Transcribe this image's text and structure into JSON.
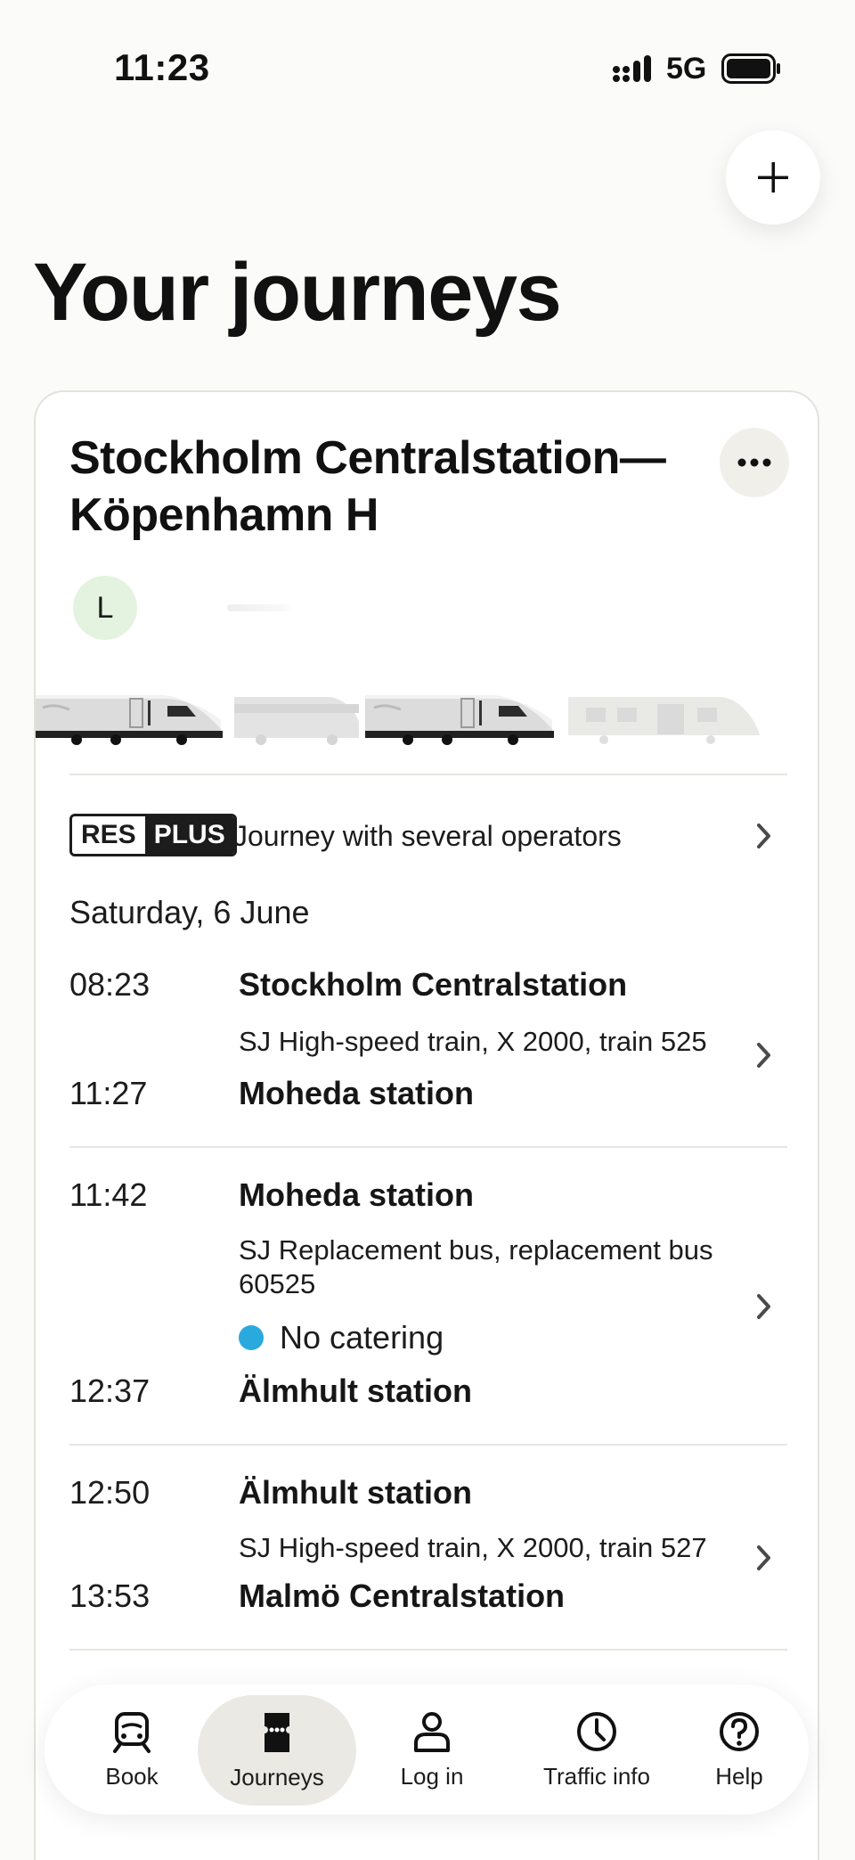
{
  "status_bar": {
    "time": "11:23",
    "network": "5G"
  },
  "page": {
    "title": "Your journeys"
  },
  "journey": {
    "route_title": "Stockholm Centralstation—Köpenhamn H",
    "route_line1": "Stockholm Centralstation—",
    "route_line2": "Köpenhamn H",
    "avatar_initial": "L",
    "res_label": "RES",
    "plus_label": "PLUS",
    "operators_text": "Journey with several operators",
    "date": "Saturday, 6 June",
    "legs": [
      {
        "dep_time": "08:23",
        "dep_station": "Stockholm Centralstation",
        "service": "SJ High-speed train, X 2000, train 525",
        "arr_time": "11:27",
        "arr_station": "Moheda station"
      },
      {
        "dep_time": "11:42",
        "dep_station": "Moheda station",
        "service": "SJ Replacement bus, replacement bus 60525",
        "catering": "No catering",
        "arr_time": "12:37",
        "arr_station": "Älmhult station"
      },
      {
        "dep_time": "12:50",
        "dep_station": "Älmhult station",
        "service": "SJ High-speed train, X 2000, train 527",
        "arr_time": "13:53",
        "arr_station": "Malmö Centralstation"
      }
    ]
  },
  "nav": [
    {
      "label": "Book",
      "icon": "train-icon"
    },
    {
      "label": "Journeys",
      "icon": "ticket-icon",
      "active": true
    },
    {
      "label": "Log in",
      "icon": "person-icon"
    },
    {
      "label": "Traffic info",
      "icon": "clock-icon"
    },
    {
      "label": "Help",
      "icon": "help-icon"
    }
  ],
  "colors": {
    "catering_dot": "#2aa9de",
    "avatar_bg": "#e3f3df",
    "active_nav_bg": "#ebe9e4"
  }
}
